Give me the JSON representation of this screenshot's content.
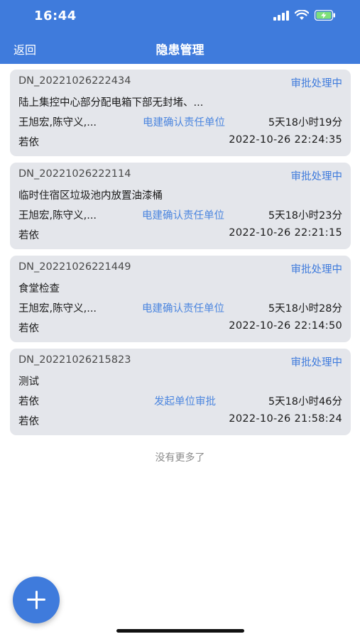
{
  "status_bar": {
    "time": "16:44"
  },
  "nav": {
    "back_label": "返回",
    "title": "隐患管理"
  },
  "items": [
    {
      "code": "DN_20221026222434",
      "status": "审批处理中",
      "description": "陆上集控中心部分配电箱下部无封堵、...",
      "people": "王旭宏,陈守义,...",
      "step": "电建确认责任单位",
      "duration": "5天18小时19分",
      "creator": "若依",
      "datetime": "2022-10-26 22:24:35"
    },
    {
      "code": "DN_20221026222114",
      "status": "审批处理中",
      "description": "临时住宿区垃圾池内放置油漆桶",
      "people": "王旭宏,陈守义,...",
      "step": "电建确认责任单位",
      "duration": "5天18小时23分",
      "creator": "若依",
      "datetime": "2022-10-26 22:21:15"
    },
    {
      "code": "DN_20221026221449",
      "status": "审批处理中",
      "description": "食堂检查",
      "people": "王旭宏,陈守义,...",
      "step": "电建确认责任单位",
      "duration": "5天18小时28分",
      "creator": "若依",
      "datetime": "2022-10-26 22:14:50"
    },
    {
      "code": "DN_20221026215823",
      "status": "审批处理中",
      "description": "测试",
      "people": "若依",
      "step": "发起单位审批",
      "duration": "5天18小时46分",
      "creator": "若依",
      "datetime": "2022-10-26 21:58:24"
    }
  ],
  "footer": {
    "no_more": "没有更多了"
  },
  "fab": {
    "icon": "plus-icon"
  },
  "colors": {
    "primary": "#3f7bdc",
    "card_bg": "#e4e6eb",
    "step_text": "#4c86df"
  }
}
